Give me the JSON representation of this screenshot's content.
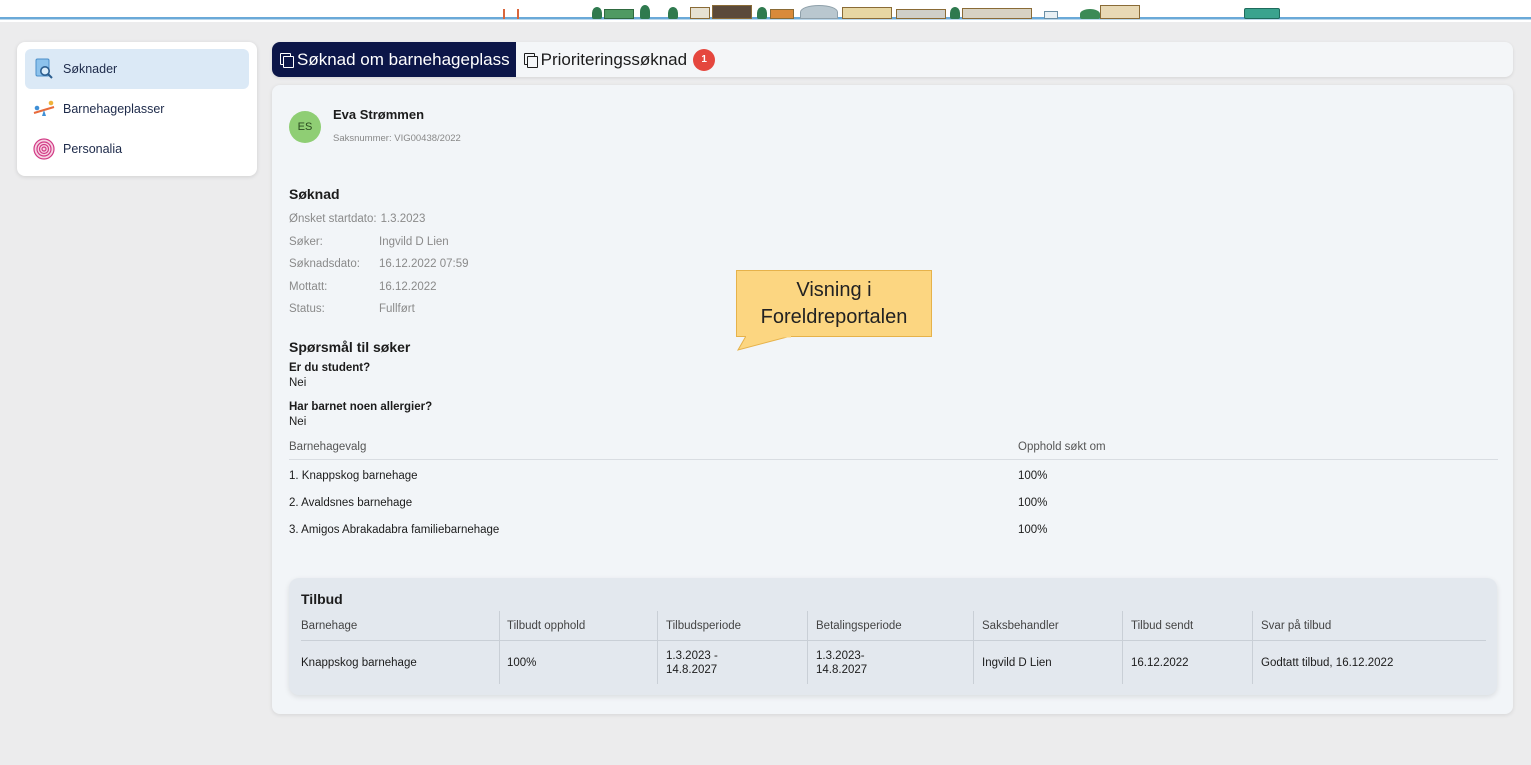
{
  "sidebar": {
    "items": [
      {
        "label": "Søknader",
        "icon": "document-search-icon",
        "active": true
      },
      {
        "label": "Barnehageplasser",
        "icon": "seesaw-icon",
        "active": false
      },
      {
        "label": "Personalia",
        "icon": "fingerprint-icon",
        "active": false
      }
    ]
  },
  "tabs": [
    {
      "label": "Søknad om barnehageplass",
      "active": true
    },
    {
      "label": "Prioriteringssøknad",
      "active": false,
      "badge": "1"
    }
  ],
  "applicant": {
    "initials": "ES",
    "name": "Eva Strømmen",
    "case_number": "Saksnummer: VIG00438/2022"
  },
  "application": {
    "heading": "Søknad",
    "fields": [
      {
        "key": "Ønsket startdato:",
        "value": "1.3.2023"
      },
      {
        "key": "Søker:",
        "value": "Ingvild D Lien"
      },
      {
        "key": "Søknadsdato:",
        "value": "16.12.2022 07:59"
      },
      {
        "key": "Mottatt:",
        "value": "16.12.2022"
      },
      {
        "key": "Status:",
        "value": "Fullført"
      }
    ]
  },
  "questions": {
    "heading": "Spørsmål til søker",
    "items": [
      {
        "question": "Er du student?",
        "answer": "Nei"
      },
      {
        "question": "Har barnet noen allergier?",
        "answer": "Nei"
      }
    ]
  },
  "choices": {
    "headers": [
      "Barnehagevalg",
      "Opphold søkt om"
    ],
    "rows": [
      [
        "1. Knappskog barnehage",
        "100%"
      ],
      [
        "2. Avaldsnes barnehage",
        "100%"
      ],
      [
        "3. Amigos Abrakadabra familiebarnehage",
        "100%"
      ]
    ]
  },
  "offer": {
    "heading": "Tilbud",
    "headers": [
      "Barnehage",
      "Tilbudt opphold",
      "Tilbudsperiode",
      "Betalingsperiode",
      "Saksbehandler",
      "Tilbud sendt",
      "Svar på tilbud"
    ],
    "row": [
      "Knappskog barnehage",
      "100%",
      "1.3.2023 -\n14.8.2027",
      "1.3.2023-\n14.8.2027",
      "Ingvild D Lien",
      "16.12.2022",
      "Godtatt tilbud, 16.12.2022"
    ]
  },
  "callout": {
    "text": "Visning i Foreldreportalen"
  },
  "colors": {
    "accent": "#0c1648",
    "badge": "#e5473e",
    "avatar": "#8fce74",
    "callout": "#fcd681"
  }
}
